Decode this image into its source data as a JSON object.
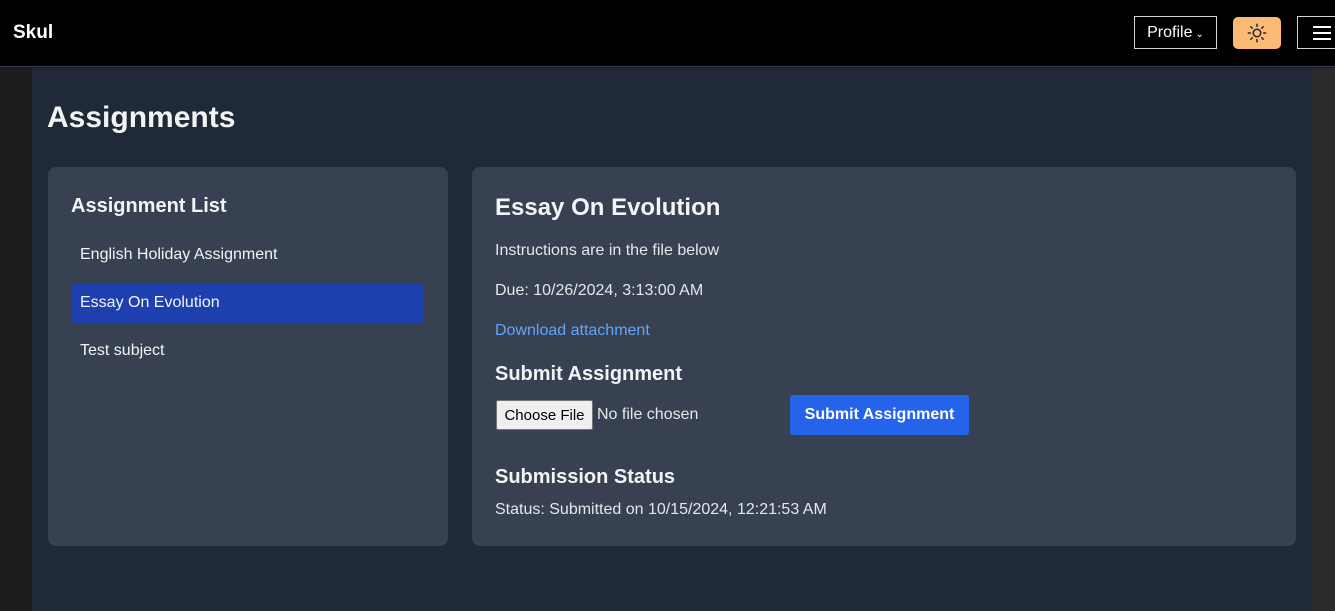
{
  "navbar": {
    "brand": "Skul",
    "profile_label": "Profile",
    "theme_icon": "sun-icon",
    "menu_icon": "hamburger-menu-icon",
    "theme_color": "#fdba74"
  },
  "page": {
    "title": "Assignments"
  },
  "assignment_list": {
    "heading": "Assignment List",
    "items": [
      {
        "label": "English Holiday Assignment",
        "active": false
      },
      {
        "label": "Essay On Evolution",
        "active": true
      },
      {
        "label": "Test subject",
        "active": false
      }
    ],
    "active_color": "#1e40af"
  },
  "detail": {
    "title": "Essay On Evolution",
    "instructions": "Instructions are in the file below",
    "due": "Due: 10/26/2024, 3:13:00 AM",
    "download_link": "Download attachment",
    "submit_heading": "Submit Assignment",
    "choose_file_label": "Choose File",
    "no_file_text": "No file chosen",
    "submit_button": "Submit Assignment",
    "status_heading": "Submission Status",
    "status_text": "Status: Submitted on 10/15/2024, 12:21:53 AM",
    "link_color": "#60a5fa",
    "button_color": "#2563eb"
  }
}
